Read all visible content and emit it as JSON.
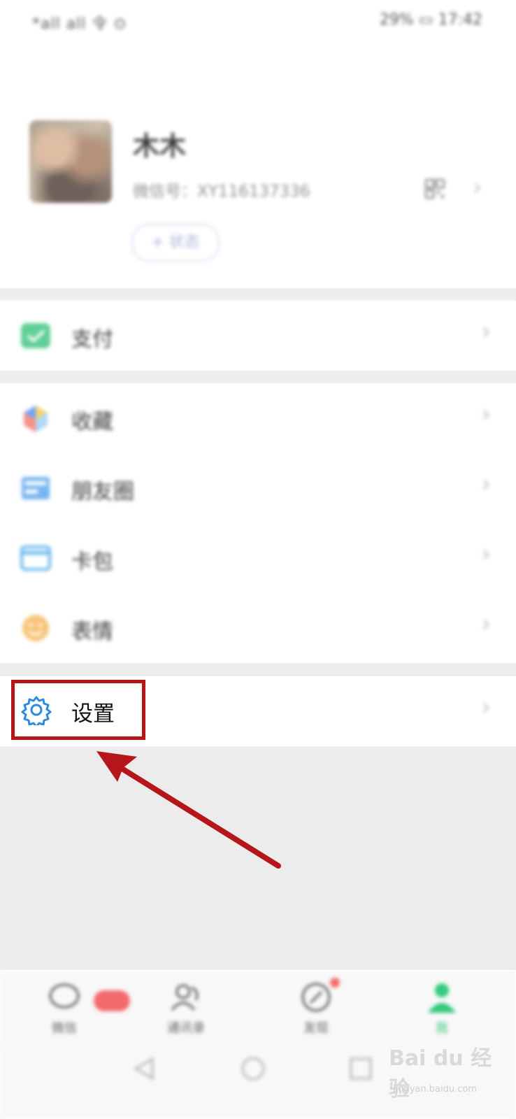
{
  "status_bar": {
    "left_text": "*all all 令 ⊙",
    "right_text": "29% ▭ 17:42"
  },
  "profile": {
    "name": "木木",
    "wechat_id": "微信号：XY116137336",
    "status_button": "+ 状态"
  },
  "menu": {
    "pay": "支付",
    "favorites": "收藏",
    "moments": "朋友圈",
    "cards": "卡包",
    "stickers": "表情",
    "settings": "设置"
  },
  "tabs": [
    {
      "label": "微信"
    },
    {
      "label": "通讯录"
    },
    {
      "label": "发现"
    },
    {
      "label": "我"
    }
  ],
  "colors": {
    "accent_green": "#07c160",
    "highlight_red": "#b5161a",
    "arrow_red": "#b5161a",
    "badge_red": "#f24b4b"
  },
  "watermark": {
    "text": "Bai du 经验",
    "subtext": "jingyan.baidu.com"
  }
}
